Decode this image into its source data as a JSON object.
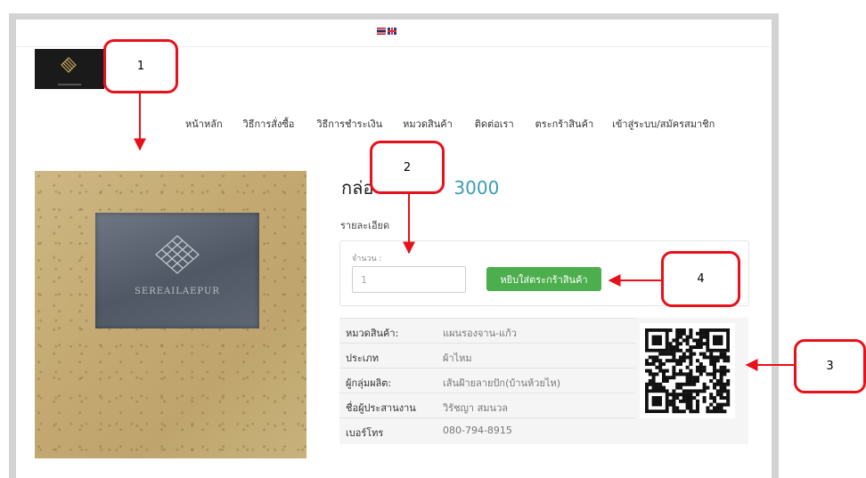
{
  "flags": [
    {
      "name": "thai-flag-icon"
    },
    {
      "name": "uk-flag-icon"
    }
  ],
  "nav": {
    "items": [
      "หน้าหลัก",
      "วิธีการสั่งซื้อ",
      "วิธีการชำระเงิน",
      "หมวดสินค้า",
      "ติดต่อเรา",
      "ตระกร้าสินค้า",
      "เข้าสู่ระบบ/สมัครสมาชิก"
    ]
  },
  "product": {
    "title_prefix": "กล่อ",
    "code": "3000",
    "image_brand_text": "SEREAILAEPUR",
    "detail_label": "รายละเอียด",
    "quantity_label": "จำนวน :",
    "quantity_value": "1",
    "add_to_cart_label": "หยิบใส่ตระกร้าสินค้า",
    "specs": [
      {
        "key": "หมวดสินค้า:",
        "value": "แผนรองจาน-แก้ว"
      },
      {
        "key": "ประเภท",
        "value": "ผ้าไหม"
      },
      {
        "key": "ผู้กลุ่มผลิต:",
        "value": "เส้นฝ้ายลายปัก(บ้านห้วยไห)"
      },
      {
        "key": "ชื่อผู้ประสานงาน",
        "value": "วิรัชญา สมนวล"
      },
      {
        "key": "เบอร์โทร",
        "value": "080-794-8915"
      }
    ]
  },
  "callouts": [
    "1",
    "2",
    "3",
    "4"
  ],
  "colors": {
    "accent": "#3a9db3",
    "button": "#4cae4c",
    "callout_red": "#e8101a"
  }
}
